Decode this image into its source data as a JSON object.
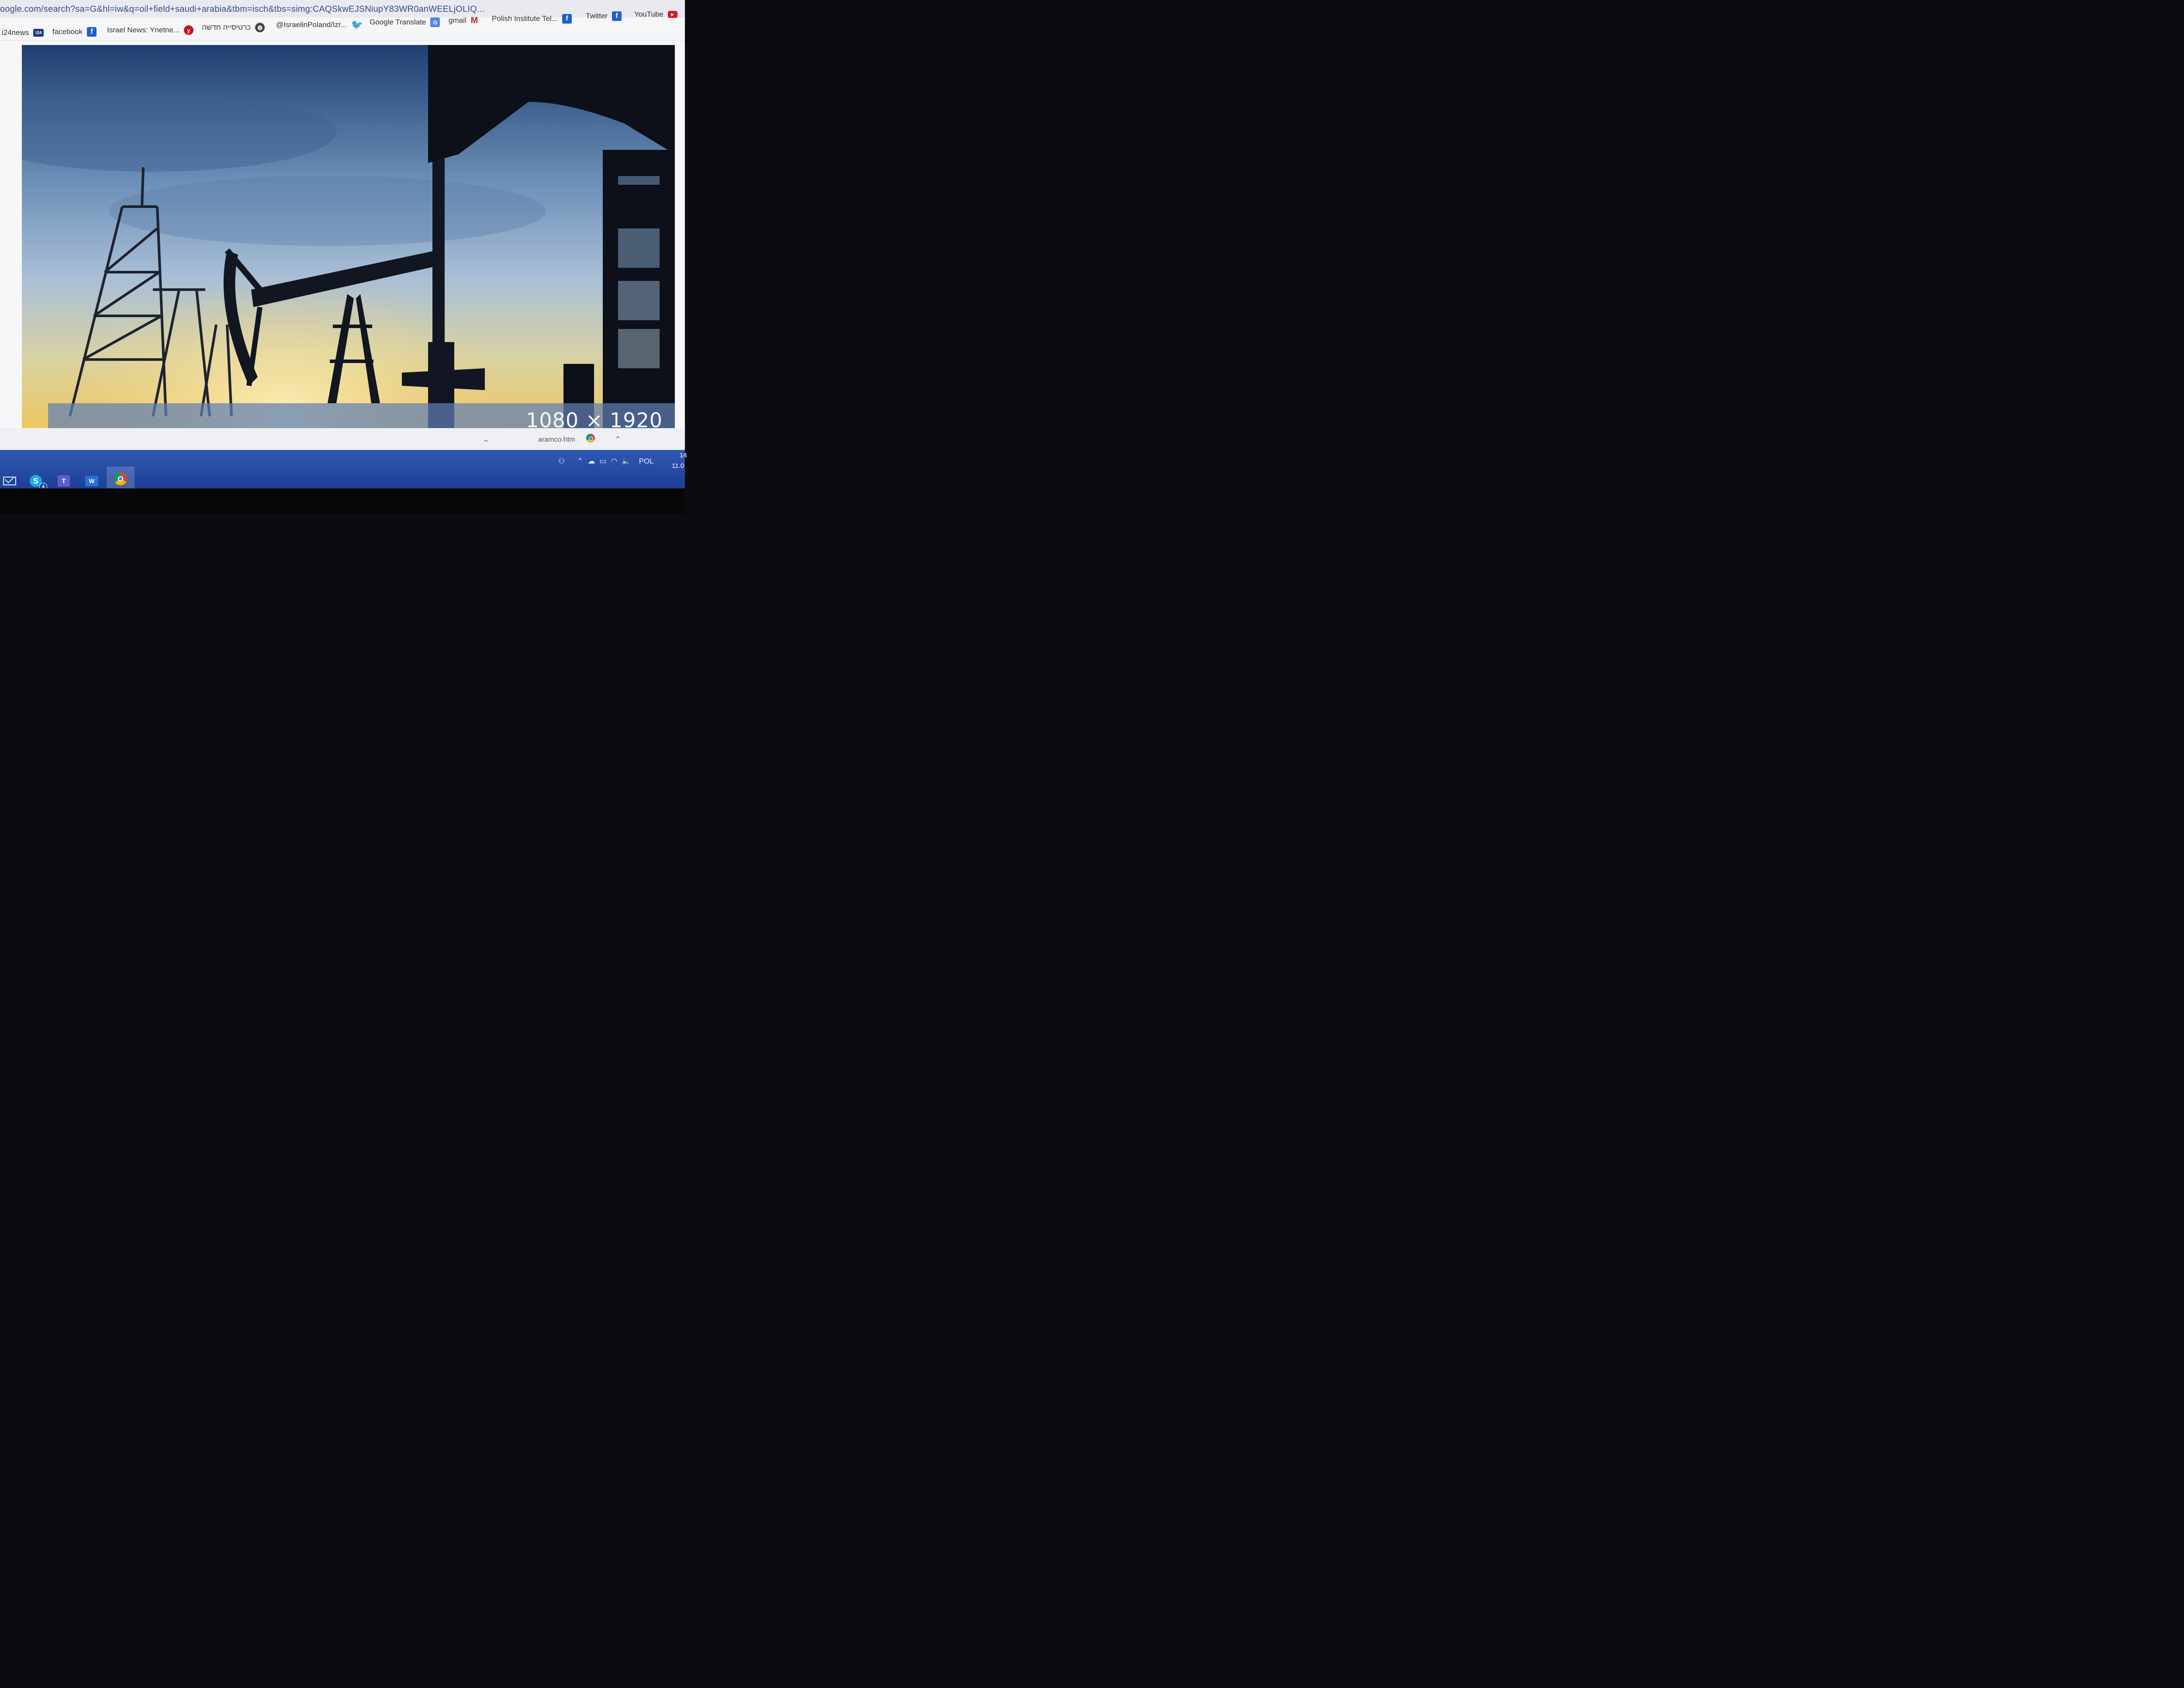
{
  "browser": {
    "url": "oogle.com/search?sa=G&hl=iw&q=oil+field+saudi+arabia&tbm=isch&tbs=simg:CAQSkwEJSNiupY83WR0anWEELjOLIQ..."
  },
  "bookmarks": [
    {
      "label": "i24news",
      "icon": "i24news-icon"
    },
    {
      "label": "facebook",
      "icon": "facebook-icon"
    },
    {
      "label": "Israel News: Ynetne...",
      "icon": "ynet-icon"
    },
    {
      "label": "כרטיסייה חדשה",
      "icon": "globe-icon"
    },
    {
      "label": "@IsraelinPoland/Izr...",
      "icon": "twitter-icon"
    },
    {
      "label": "Google Translate",
      "icon": "google-translate-icon"
    },
    {
      "label": "gmail",
      "icon": "gmail-icon"
    },
    {
      "label": "Polish Institute Tel...",
      "icon": "facebook-icon"
    },
    {
      "label": "Twitter",
      "icon": "facebook-icon"
    },
    {
      "label": "YouTube",
      "icon": "youtube-icon"
    }
  ],
  "image_preview": {
    "dimensions": "1080 × 1920",
    "subject": "oil-field-pumpjack-silhouette"
  },
  "download_bar": {
    "filename": "aramco.htm"
  },
  "taskbar": {
    "skype_badge": "4",
    "tray_language": "POL",
    "time": "14",
    "date": "11.0"
  },
  "colors": {
    "taskbar": "#2f58b4",
    "url_text": "#3a4a90",
    "dimension_band": "#6080b4"
  }
}
